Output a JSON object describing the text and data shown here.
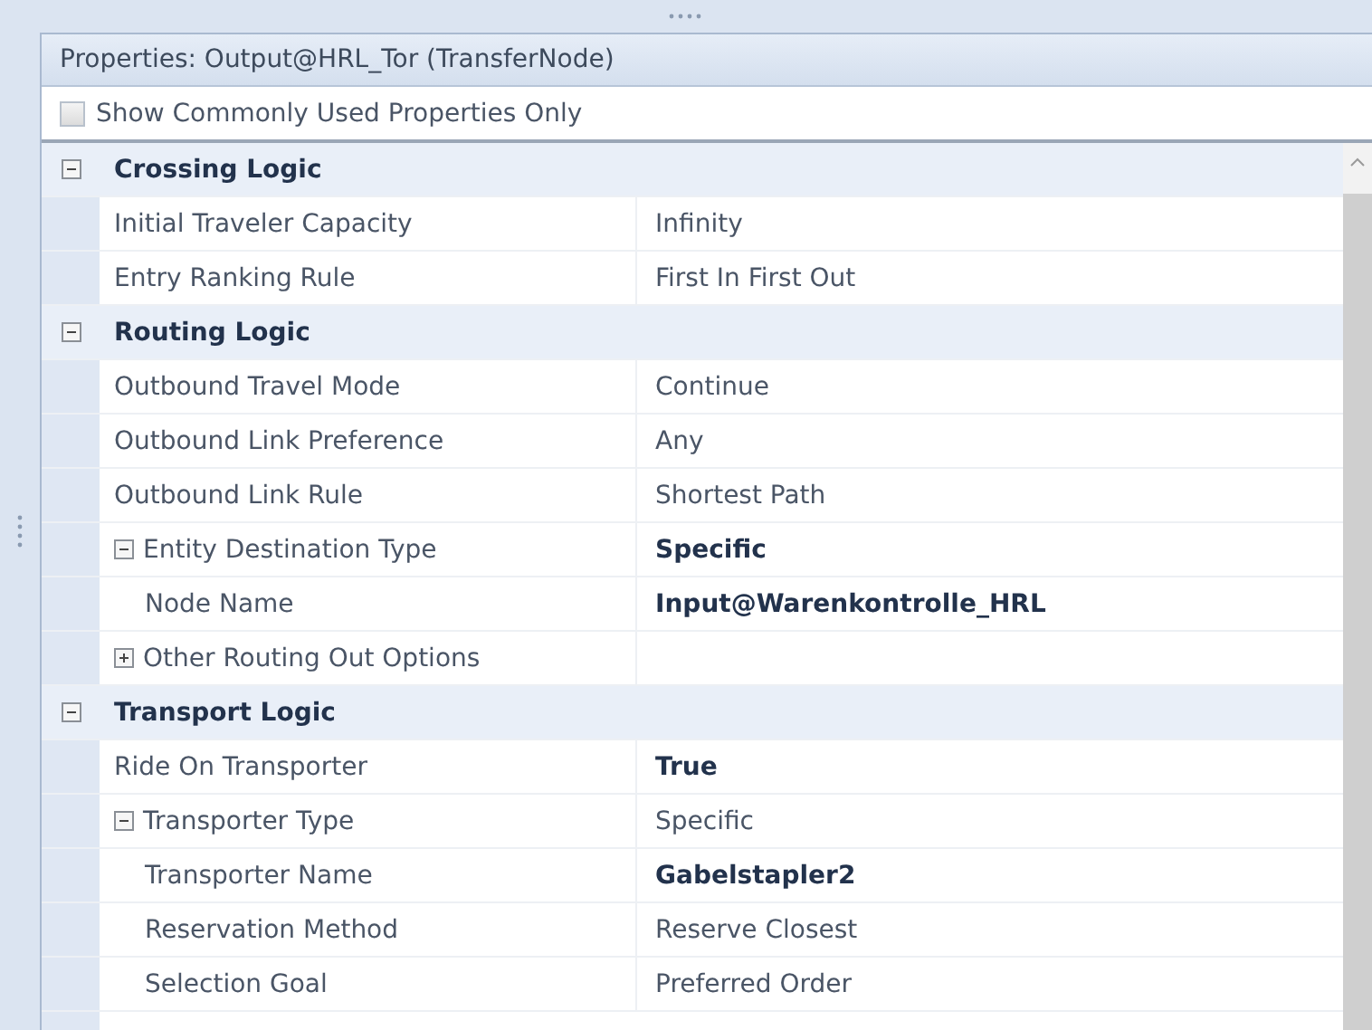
{
  "panel": {
    "title": "Properties: Output@HRL_Tor (TransferNode)"
  },
  "filter": {
    "label": "Show Commonly Used Properties Only",
    "checked": false
  },
  "categories": [
    {
      "name": "Crossing Logic",
      "expanded": true,
      "properties": [
        {
          "name": "Initial Traveler Capacity",
          "value": "Infinity",
          "bold": false
        },
        {
          "name": "Entry Ranking Rule",
          "value": "First In First Out",
          "bold": false
        }
      ]
    },
    {
      "name": "Routing Logic",
      "expanded": true,
      "properties": [
        {
          "name": "Outbound Travel Mode",
          "value": "Continue",
          "bold": false
        },
        {
          "name": "Outbound Link Preference",
          "value": "Any",
          "bold": false
        },
        {
          "name": "Outbound Link Rule",
          "value": "Shortest Path",
          "bold": false
        },
        {
          "name": "Entity Destination Type",
          "value": "Specific",
          "bold": true,
          "expanded": true,
          "children": [
            {
              "name": "Node Name",
              "value": "Input@Warenkontrolle_HRL",
              "bold": true
            }
          ]
        },
        {
          "name": "Other Routing Out Options",
          "expanded": false
        }
      ]
    },
    {
      "name": "Transport Logic",
      "expanded": true,
      "properties": [
        {
          "name": "Ride On Transporter",
          "value": "True",
          "bold": true
        },
        {
          "name": "Transporter Type",
          "value": "Specific",
          "bold": false,
          "expanded": true,
          "children": [
            {
              "name": "Transporter Name",
              "value": "Gabelstapler2",
              "bold": true
            },
            {
              "name": "Reservation Method",
              "value": "Reserve Closest",
              "bold": false
            },
            {
              "name": "Selection Goal",
              "value": "Preferred Order",
              "bold": false
            }
          ]
        }
      ]
    }
  ]
}
